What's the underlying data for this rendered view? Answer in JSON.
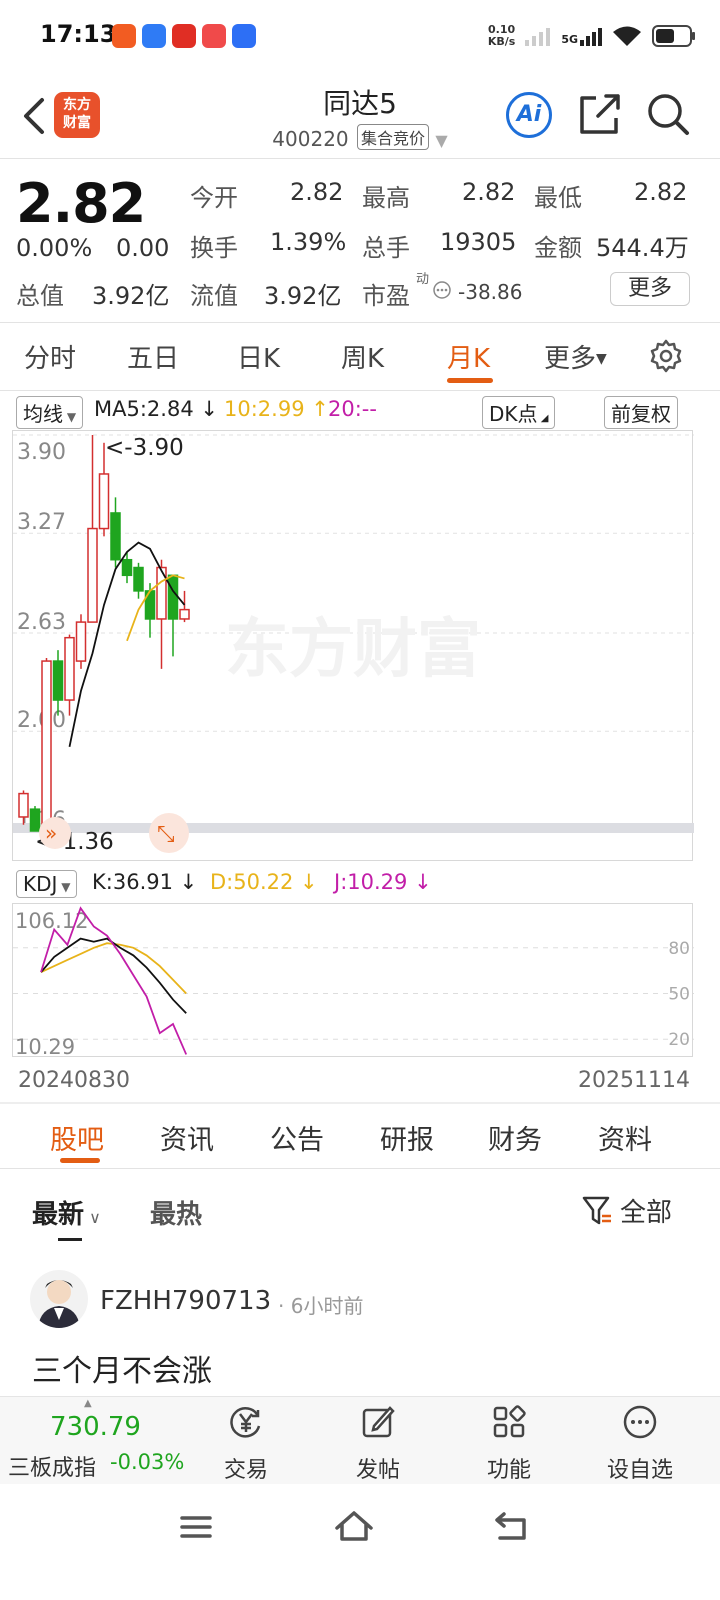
{
  "status": {
    "time": "17:13",
    "net_speed_value": "0.10",
    "net_speed_unit": "KB/s",
    "net_type": "5G",
    "app_icons": [
      {
        "name": "feishu-app-icon",
        "color": "#f25c22"
      },
      {
        "name": "browser-app-icon",
        "color": "#2f7bf5"
      },
      {
        "name": "pinduoduo-app-icon",
        "color": "#e02e24"
      },
      {
        "name": "video-app-icon",
        "color": "#f04a4a"
      },
      {
        "name": "vivo-app-icon",
        "color": "#2d6ff5"
      }
    ]
  },
  "header": {
    "brand_line1": "东方",
    "brand_line2": "财富",
    "stock_name": "同达5",
    "stock_code": "400220",
    "auction_tag": "集合竞价",
    "ai_label": "Ai"
  },
  "quote": {
    "price": "2.82",
    "change_pct": "0.00%",
    "change": "0.00",
    "open_label": "今开",
    "open": "2.82",
    "high_label": "最高",
    "high": "2.82",
    "low_label": "最低",
    "low": "2.82",
    "turnover_label": "换手",
    "turnover": "1.39%",
    "volume_label": "总手",
    "volume": "19305",
    "amount_label": "金额",
    "amount": "544.4万",
    "total_value_label": "总值",
    "total_value": "3.92亿",
    "float_value_label": "流值",
    "float_value": "3.92亿",
    "pe_label": "市盈",
    "pe_superscript": "动",
    "pe": "-38.86",
    "more_label": "更多"
  },
  "period_tabs": [
    "分时",
    "五日",
    "日K",
    "周K",
    "月K",
    "更多"
  ],
  "active_period": "月K",
  "ma_bar": {
    "indicator": "均线",
    "ma5": "MA5:2.84",
    "ma10": "10:2.99",
    "ma20": "20:--",
    "dk_label": "DK点",
    "adjust_label": "前复权"
  },
  "chart_data": {
    "type": "candlestick",
    "y_ticks": [
      "3.90",
      "3.27",
      "2.63",
      "2.00",
      "1.36"
    ],
    "ylim": [
      1.36,
      3.9
    ],
    "max_marker": "<-3.90",
    "min_marker": "<-1.36",
    "watermark": "东方财富",
    "candles": [
      {
        "o": 1.45,
        "c": 1.6,
        "h": 1.62,
        "l": 1.4
      },
      {
        "o": 1.5,
        "c": 1.36,
        "h": 1.52,
        "l": 1.36
      },
      {
        "o": 1.4,
        "c": 2.45,
        "h": 2.47,
        "l": 1.4
      },
      {
        "o": 2.45,
        "c": 2.2,
        "h": 2.52,
        "l": 2.1
      },
      {
        "o": 2.2,
        "c": 2.6,
        "h": 2.62,
        "l": 2.1
      },
      {
        "o": 2.45,
        "c": 2.7,
        "h": 2.75,
        "l": 2.4
      },
      {
        "o": 2.7,
        "c": 3.3,
        "h": 3.9,
        "l": 2.7
      },
      {
        "o": 3.3,
        "c": 3.65,
        "h": 3.85,
        "l": 3.25
      },
      {
        "o": 3.4,
        "c": 3.1,
        "h": 3.5,
        "l": 3.05
      },
      {
        "o": 3.1,
        "c": 3.0,
        "h": 3.15,
        "l": 2.95
      },
      {
        "o": 3.05,
        "c": 2.9,
        "h": 3.08,
        "l": 2.85
      },
      {
        "o": 2.9,
        "c": 2.72,
        "h": 2.95,
        "l": 2.6
      },
      {
        "o": 2.72,
        "c": 3.05,
        "h": 3.1,
        "l": 2.4
      },
      {
        "o": 3.0,
        "c": 2.72,
        "h": 3.0,
        "l": 2.48
      },
      {
        "o": 2.72,
        "c": 2.78,
        "h": 2.9,
        "l": 2.7
      }
    ],
    "ma5": [
      null,
      null,
      null,
      null,
      1.9,
      2.26,
      2.5,
      2.81,
      3.04,
      3.15,
      3.21,
      3.17,
      3.03,
      2.9,
      2.81
    ],
    "ma10": [
      null,
      null,
      null,
      null,
      null,
      null,
      null,
      null,
      null,
      2.58,
      2.78,
      2.9,
      2.96,
      3.0,
      2.98
    ]
  },
  "kdj": {
    "indicator": "KDJ",
    "k_label": "K:36.91",
    "d_label": "D:50.22",
    "j_label": "J:10.29",
    "max_label": "106.12",
    "min_label": "10.29",
    "levels": [
      "80",
      "50",
      "20"
    ],
    "ylim": [
      10.29,
      106.12
    ],
    "k": [
      64,
      74,
      80,
      86,
      84,
      86,
      80,
      75,
      67,
      57,
      46,
      37
    ],
    "d": [
      64,
      68,
      72,
      76,
      80,
      83,
      82,
      80,
      75,
      68,
      59,
      50
    ],
    "j": [
      64,
      92,
      82,
      106,
      94,
      88,
      76,
      62,
      48,
      24,
      30,
      10
    ]
  },
  "x_axis": {
    "start": "20240830",
    "end": "20251114"
  },
  "f10_tabs": [
    "股吧",
    "资讯",
    "公告",
    "研报",
    "财务",
    "资料"
  ],
  "active_f10": "股吧",
  "forum": {
    "sort_latest": "最新",
    "sort_hot": "最热",
    "filter_label": "全部",
    "post": {
      "user": "FZHH790713",
      "time": "6小时前",
      "content": "三个月不会涨"
    }
  },
  "bottom": {
    "index_value": "730.79",
    "index_name": "三板成指",
    "index_change": "-0.03%",
    "items": [
      "交易",
      "发帖",
      "功能",
      "设自选"
    ]
  },
  "colors": {
    "up": "#d32f2f",
    "down": "#1fa51f",
    "accent": "#e35d13",
    "ma10": "#e8b31a",
    "kdj_j": "#c21ea8"
  }
}
